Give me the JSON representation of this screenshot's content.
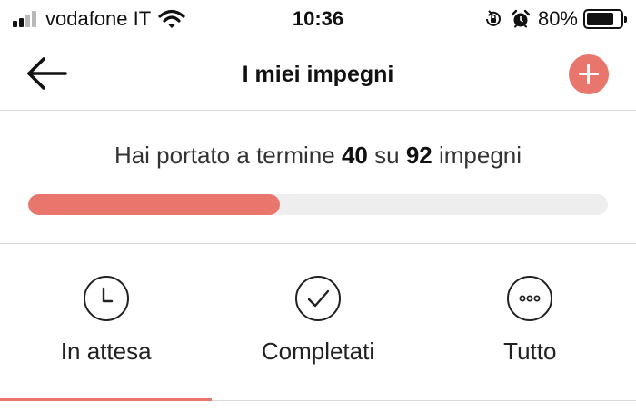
{
  "status_bar": {
    "carrier": "vodafone IT",
    "time": "10:36",
    "battery_percent": "80%",
    "battery_level": 0.8,
    "signal_bars_active": 2,
    "signal_bars_total": 4,
    "icons": [
      "signal-icon",
      "wifi-icon",
      "rotation-lock-icon",
      "alarm-icon",
      "battery-icon"
    ]
  },
  "header": {
    "title": "I miei impegni",
    "back_icon": "arrow-left-icon",
    "add_icon": "plus-icon"
  },
  "progress": {
    "text_prefix": "Hai portato a termine",
    "completed": "40",
    "text_middle": "su",
    "total": "92",
    "text_suffix": "impegni",
    "completed_value": 40,
    "total_value": 92
  },
  "tabs": [
    {
      "label": "In attesa",
      "icon": "clock-icon",
      "active": true
    },
    {
      "label": "Completati",
      "icon": "checkmark-icon",
      "active": false
    },
    {
      "label": "Tutto",
      "icon": "more-dots-icon",
      "active": false
    }
  ],
  "colors": {
    "accent": "#e8766c",
    "track": "#eeeeee",
    "divider": "#d9d9d9",
    "text": "#222222"
  }
}
